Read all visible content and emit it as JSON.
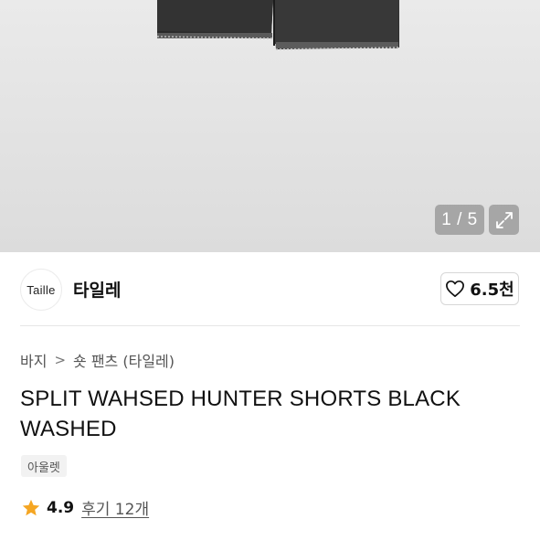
{
  "gallery": {
    "counter": "1 / 5",
    "image_alt": "black washed denim shorts"
  },
  "brand": {
    "logo_text": "Taille",
    "name": "타일레"
  },
  "like": {
    "count": "6.5천"
  },
  "breadcrumb": {
    "items": [
      "바지",
      "숏 팬츠 (타일레)"
    ],
    "separator": ">"
  },
  "product": {
    "title": "SPLIT WAHSED HUNTER SHORTS BLACK WASHED",
    "tag": "아울렛"
  },
  "rating": {
    "score": "4.9",
    "reviews": "후기 12개",
    "star_color": "#f5a623"
  },
  "icons": [
    "heart-icon",
    "expand-icon",
    "chevron-right-icon",
    "star-icon"
  ]
}
